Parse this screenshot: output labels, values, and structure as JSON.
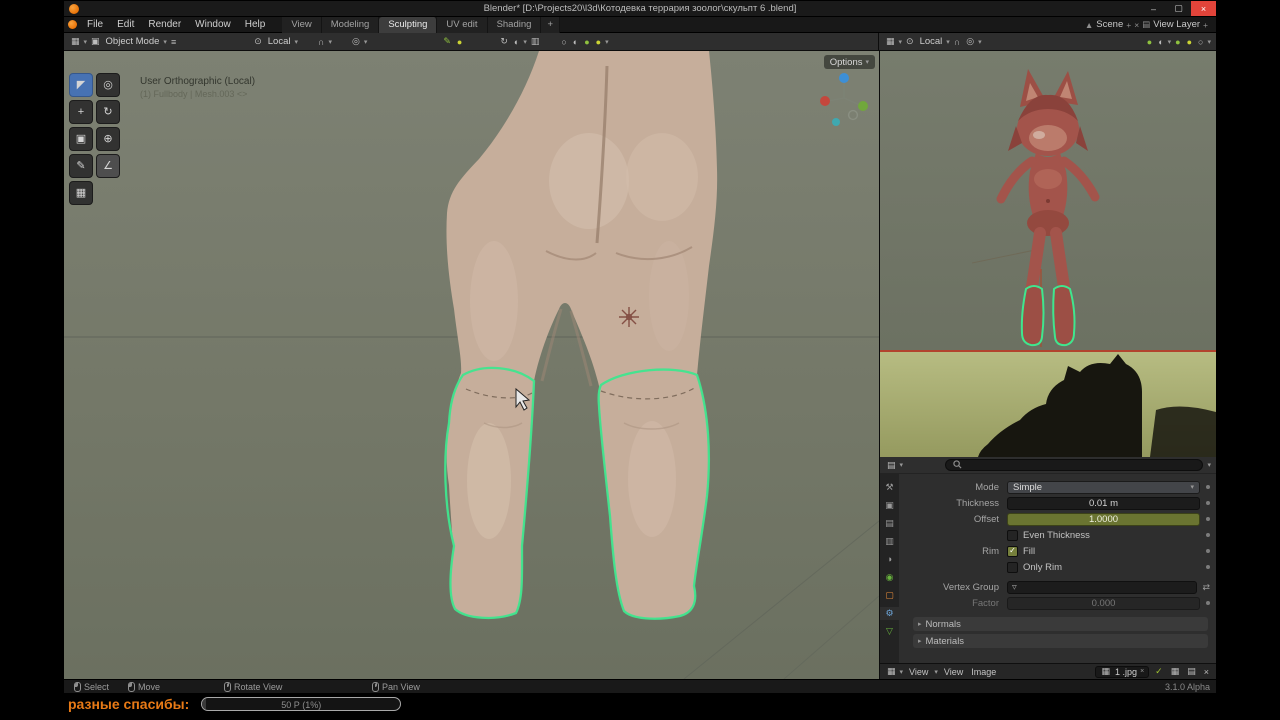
{
  "titlebar": {
    "title": "Blender* [D:\\Projects20\\l3d\\Котодевка террария зоолог\\скульпт 6 .blend]"
  },
  "menubar": {
    "menus": [
      "File",
      "Edit",
      "Render",
      "Window",
      "Help"
    ],
    "workspaces": [
      "View",
      "Modeling",
      "Sculpting",
      "UV edit",
      "Shading",
      "+"
    ],
    "active_workspace": "Sculpting",
    "scene": "Scene",
    "view_layer": "View Layer"
  },
  "header_left": {
    "mode": "Object Mode",
    "orientation": "Local"
  },
  "header_right": {
    "orientation": "Local"
  },
  "viewport": {
    "overlay_line1": "User Orthographic (Local)",
    "overlay_line2": "(1) Fullbody | Mesh.003 <>",
    "options": "Options"
  },
  "tools": [
    {
      "name": "select-box",
      "glyph": "◤"
    },
    {
      "name": "cursor",
      "glyph": "◎"
    },
    {
      "name": "move",
      "glyph": "+"
    },
    {
      "name": "rotate",
      "glyph": "↻"
    },
    {
      "name": "scale",
      "glyph": "▣"
    },
    {
      "name": "transform",
      "glyph": "⊕"
    },
    {
      "name": "annotate",
      "glyph": "✎"
    },
    {
      "name": "measure",
      "glyph": "∠"
    },
    {
      "name": "add-cube",
      "glyph": "▦"
    }
  ],
  "properties": {
    "mode_label": "Mode",
    "mode_value": "Simple",
    "thickness_label": "Thickness",
    "thickness_value": "0.01 m",
    "offset_label": "Offset",
    "offset_value": "1.0000",
    "even_thickness": "Even Thickness",
    "rim_label": "Rim",
    "fill": "Fill",
    "only_rim": "Only Rim",
    "vertex_group_label": "Vertex Group",
    "factor_label": "Factor",
    "factor_value": "0.000",
    "section_normals": "Normals",
    "section_materials": "Materials"
  },
  "image_editor": {
    "mode": "View",
    "menus": [
      "View",
      "Image"
    ],
    "image_name": "1 .jpg"
  },
  "statusbar": {
    "select": "Select",
    "move": "Move",
    "rotate": "Rotate View",
    "pan": "Pan View",
    "version": "3.1.0 Alpha"
  },
  "donation": {
    "label": "разные спасибы:",
    "progress_text": "50 Р (1%)"
  },
  "colors": {
    "selection_green": "#3fe68e",
    "tool_active_blue": "#4772b3",
    "donation_orange": "#e87a16",
    "offset_olive": "#6a7431",
    "close_red": "#e2443a"
  },
  "icons": {
    "minimize": "–",
    "maximize": "▢",
    "close": "×",
    "chevron_down": "▾",
    "chevron_right": "▸",
    "hamburger": "≡",
    "grid": "▦",
    "cube": "▣",
    "pivot": "⊙",
    "magnet": "∩",
    "proportional": "◎",
    "pencil": "✎",
    "rotate": "↻",
    "overlay": "◐",
    "xray": "▥",
    "ball_solid": "●",
    "ball_outline": "○",
    "ball_half": "◐",
    "plus": "+",
    "cross": "×",
    "swap": "⇄",
    "check": "✓",
    "scene": "▲",
    "layers": "▤",
    "image": "▦",
    "properties": "▤",
    "hammer": "⚒",
    "camera": "▣",
    "printer": "▤",
    "viewlayer": "▥",
    "scene_tab": "◑",
    "world": "◉",
    "object_tab": "▢",
    "gear": "⚙",
    "data_tab": "▽",
    "vgroup": "▿"
  }
}
